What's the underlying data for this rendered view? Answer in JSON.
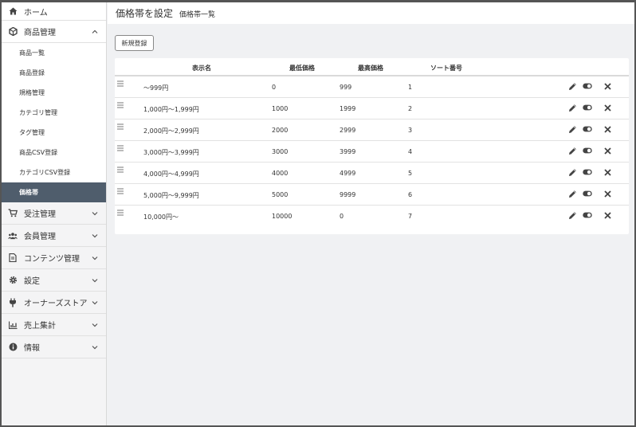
{
  "sidebar": {
    "home_label": "ホーム",
    "product_mgmt_label": "商品管理",
    "product_sub": [
      "商品一覧",
      "商品登録",
      "規格管理",
      "カテゴリ管理",
      "タグ管理",
      "商品CSV登録",
      "カテゴリCSV登録",
      "価格帯"
    ],
    "order_label": "受注管理",
    "member_label": "会員管理",
    "content_label": "コンテンツ管理",
    "settings_label": "設定",
    "owners_label": "オーナーズストア",
    "sales_label": "売上集計",
    "info_label": "情報"
  },
  "header": {
    "title": "価格帯を設定",
    "subtitle": "価格帯一覧"
  },
  "toolbar": {
    "new_label": "新規登録"
  },
  "table": {
    "headers": {
      "name": "表示名",
      "min": "最低価格",
      "max": "最高価格",
      "sort": "ソート番号"
    },
    "rows": [
      {
        "name": "～999円",
        "min": "0",
        "max": "999",
        "sort": "1"
      },
      {
        "name": "1,000円～1,999円",
        "min": "1000",
        "max": "1999",
        "sort": "2"
      },
      {
        "name": "2,000円～2,999円",
        "min": "2000",
        "max": "2999",
        "sort": "3"
      },
      {
        "name": "3,000円～3,999円",
        "min": "3000",
        "max": "3999",
        "sort": "4"
      },
      {
        "name": "4,000円～4,999円",
        "min": "4000",
        "max": "4999",
        "sort": "5"
      },
      {
        "name": "5,000円～9,999円",
        "min": "5000",
        "max": "9999",
        "sort": "6"
      },
      {
        "name": "10,000円～",
        "min": "10000",
        "max": "0",
        "sort": "7"
      }
    ]
  },
  "colors": {
    "active_bg": "#4f5d6c",
    "icon": "#444444"
  }
}
